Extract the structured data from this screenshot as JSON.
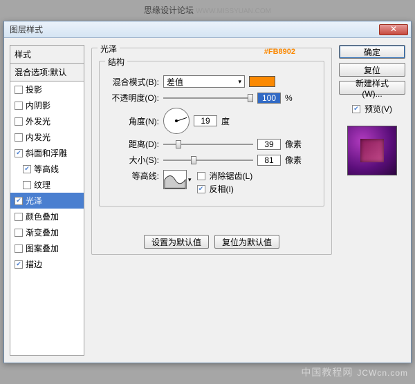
{
  "header": {
    "main": "思缘设计论坛",
    "sub": "WWW.MISSYUAN.COM"
  },
  "dialog": {
    "title": "图层样式"
  },
  "sidebar": {
    "heading": "样式",
    "defaults": "混合选项:默认",
    "items": [
      {
        "label": "投影",
        "checked": false,
        "indent": false
      },
      {
        "label": "内阴影",
        "checked": false,
        "indent": false
      },
      {
        "label": "外发光",
        "checked": false,
        "indent": false
      },
      {
        "label": "内发光",
        "checked": false,
        "indent": false
      },
      {
        "label": "斜面和浮雕",
        "checked": true,
        "indent": false
      },
      {
        "label": "等高线",
        "checked": true,
        "indent": true
      },
      {
        "label": "纹理",
        "checked": false,
        "indent": true
      },
      {
        "label": "光泽",
        "checked": true,
        "indent": false,
        "selected": true
      },
      {
        "label": "颜色叠加",
        "checked": false,
        "indent": false
      },
      {
        "label": "渐变叠加",
        "checked": false,
        "indent": false
      },
      {
        "label": "图案叠加",
        "checked": false,
        "indent": false
      },
      {
        "label": "描边",
        "checked": true,
        "indent": false
      }
    ]
  },
  "panel": {
    "title": "光泽",
    "subtitle": "结构",
    "color_hex": "#FB8902",
    "blend_label": "混合模式(B):",
    "blend_value": "差值",
    "opacity_label": "不透明度(O):",
    "opacity_value": "100",
    "percent": "%",
    "angle_label": "角度(N):",
    "angle_value": "19",
    "angle_unit": "度",
    "distance_label": "距离(D):",
    "distance_value": "39",
    "size_label": "大小(S):",
    "size_value": "81",
    "px_unit": "像素",
    "contour_label": "等高线:",
    "antialias_label": "消除锯齿(L)",
    "invert_label": "反相(I)",
    "antialias_checked": false,
    "invert_checked": true,
    "set_default": "设置为默认值",
    "reset_default": "复位为默认值"
  },
  "right": {
    "ok": "确定",
    "cancel": "复位",
    "new_style": "新建样式(W)...",
    "preview_label": "预览(V)",
    "preview_checked": true
  },
  "watermark": {
    "cn": "中国教程网",
    "en": "JCWcn.com"
  }
}
